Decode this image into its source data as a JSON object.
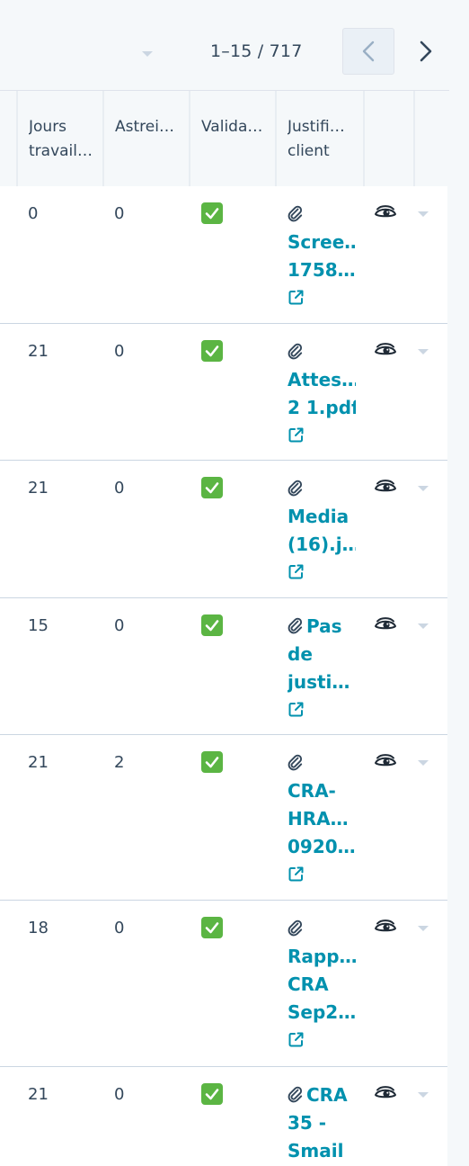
{
  "pagination": {
    "range": "1–15 / 717",
    "prev_icon": "chevron-left-icon",
    "next_icon": "chevron-right-icon"
  },
  "columns": [
    {
      "lines": [
        "Jours",
        "travail…"
      ]
    },
    {
      "lines": [
        "Astrei…"
      ]
    },
    {
      "lines": [
        "Valida…"
      ]
    },
    {
      "lines": [
        "Justifi…",
        "client"
      ]
    }
  ],
  "icons": {
    "validated": "check-mark-button-icon",
    "attachment": "paperclip-icon",
    "external": "external-link-icon",
    "preview": "eye-icon",
    "row_menu": "caret-down-icon"
  },
  "colors": {
    "link": "#0091ae",
    "validated": "#5bb543",
    "text": "#33475b"
  },
  "rows": [
    {
      "jours": "0",
      "astreinte": "0",
      "justif_lines": [
        "Scree…",
        "1758…"
      ]
    },
    {
      "jours": "21",
      "astreinte": "0",
      "justif_lines": [
        "Attes…",
        "2 1.pdf"
      ]
    },
    {
      "jours": "21",
      "astreinte": "0",
      "justif_lines": [
        "Media",
        "(16).j…"
      ]
    },
    {
      "jours": "15",
      "astreinte": "0",
      "justif_lines": [
        "Pas",
        "de",
        "justi…"
      ]
    },
    {
      "jours": "21",
      "astreinte": "2",
      "justif_lines": [
        "CRA-",
        "HRA…",
        "0920…"
      ]
    },
    {
      "jours": "18",
      "astreinte": "0",
      "justif_lines": [
        "Rapp…",
        "CRA",
        "Sep2…"
      ]
    },
    {
      "jours": "21",
      "astreinte": "0",
      "justif_lines": [
        "CRA",
        "35 -",
        "Smail"
      ]
    }
  ]
}
